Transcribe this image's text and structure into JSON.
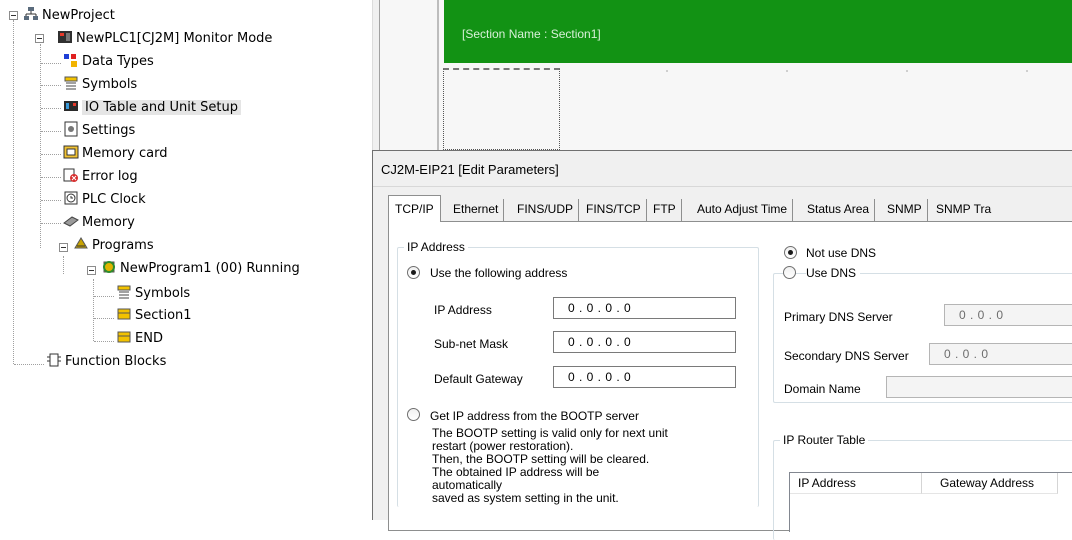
{
  "tree": {
    "root": "NewProject",
    "plc": "NewPLC1[CJ2M] Monitor Mode",
    "plc_children": [
      "Data Types",
      "Symbols",
      "IO Table and Unit Setup",
      "Settings",
      "Memory card",
      "Error log",
      "PLC Clock",
      "Memory"
    ],
    "programs": "Programs",
    "program": "NewProgram1 (00) Running",
    "program_children": [
      "Symbols",
      "Section1",
      "END"
    ],
    "function_blocks": "Function Blocks"
  },
  "ladder": {
    "section_label": "[Section Name : Section1]"
  },
  "dialog": {
    "title": "CJ2M-EIP21 [Edit Parameters]",
    "tabs": [
      "TCP/IP",
      "Ethernet",
      "FINS/UDP",
      "FINS/TCP",
      "FTP",
      "Auto Adjust Time",
      "Status Area",
      "SNMP",
      "SNMP Tra"
    ],
    "ip_group": {
      "title": "IP Address",
      "use_following": "Use the following address",
      "ip_address_label": "IP Address",
      "ip_address_value": "0  .  0  .  0  .  0",
      "subnet_label": "Sub-net Mask",
      "subnet_value": "0  .  0  .  0  .  0",
      "gateway_label": "Default Gateway",
      "gateway_value": "0  .  0  .  0  .  0",
      "bootp_label": "Get IP address from the BOOTP server",
      "bootp_note_1": "The BOOTP setting is valid only for next unit",
      "bootp_note_2": "restart (power restoration).",
      "bootp_note_3": "Then, the BOOTP setting will be cleared.",
      "bootp_note_4": "The obtained IP address will be automatically",
      "bootp_note_5": "saved as system setting in the unit."
    },
    "dns": {
      "not_use": "Not use DNS",
      "use": "Use DNS",
      "primary_label": "Primary DNS Server",
      "primary_value": "0  .  0  .  0",
      "secondary_label": "Secondary DNS Server",
      "secondary_value": "0  .  0  .  0",
      "domain_label": "Domain Name",
      "domain_value": ""
    },
    "router": {
      "title": "IP Router Table",
      "col_ip": "IP Address",
      "col_gateway": "Gateway Address"
    }
  }
}
